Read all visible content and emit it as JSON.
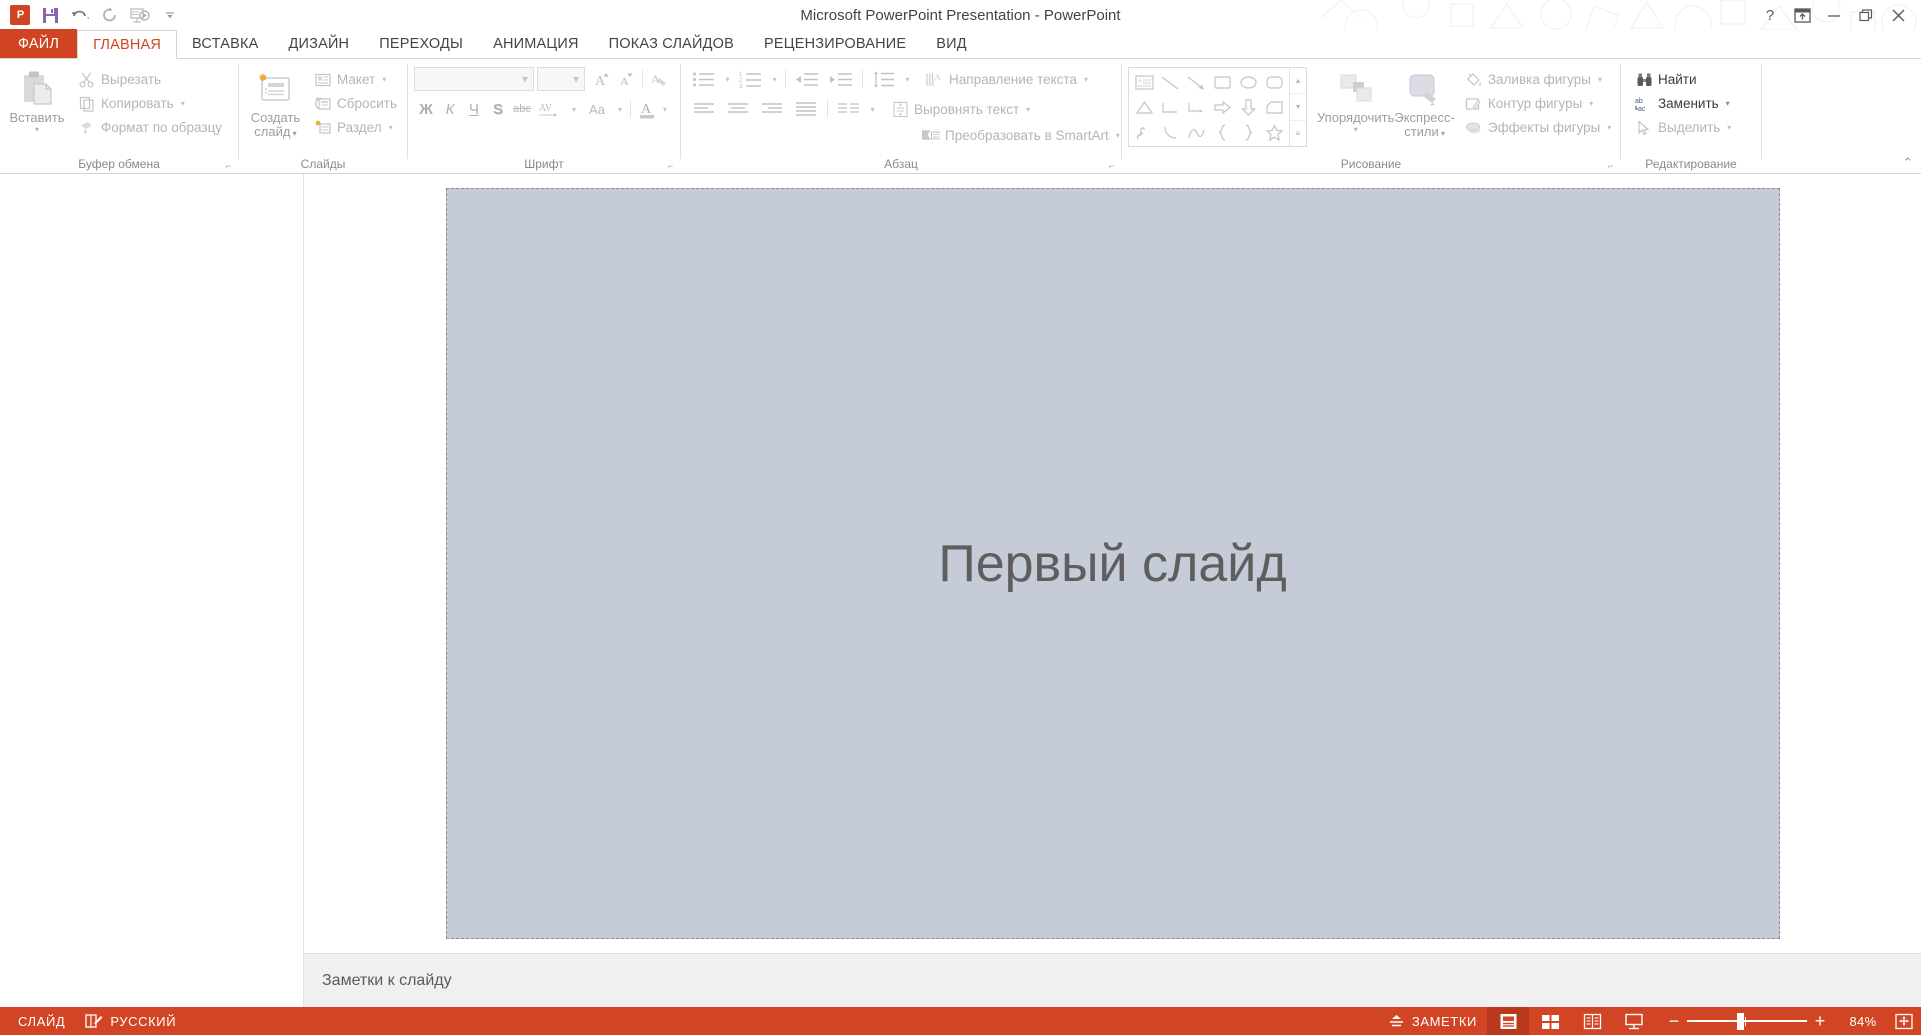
{
  "titlebar": {
    "app_icon": "powerpoint-logo",
    "title": "Microsoft PowerPoint Presentation - PowerPoint",
    "qat": [
      {
        "name": "save",
        "icon": "save-icon"
      },
      {
        "name": "undo",
        "icon": "undo-icon"
      },
      {
        "name": "redo",
        "icon": "redo-icon"
      },
      {
        "name": "start-slideshow",
        "icon": "slideshow-icon"
      },
      {
        "name": "customize-qat",
        "icon": "chevron-down-icon"
      }
    ],
    "window_buttons": [
      {
        "name": "help",
        "glyph": "?"
      },
      {
        "name": "ribbon-display-options",
        "glyph": "ribbon"
      },
      {
        "name": "minimize",
        "glyph": "–"
      },
      {
        "name": "restore",
        "glyph": "restore"
      },
      {
        "name": "close",
        "glyph": "✕"
      }
    ]
  },
  "tabs": [
    {
      "label": "ФАЙЛ",
      "type": "file"
    },
    {
      "label": "ГЛАВНАЯ",
      "type": "active"
    },
    {
      "label": "ВСТАВКА",
      "type": "normal"
    },
    {
      "label": "ДИЗАЙН",
      "type": "normal"
    },
    {
      "label": "ПЕРЕХОДЫ",
      "type": "normal"
    },
    {
      "label": "АНИМАЦИЯ",
      "type": "normal"
    },
    {
      "label": "ПОКАЗ СЛАЙДОВ",
      "type": "normal"
    },
    {
      "label": "РЕЦЕНЗИРОВАНИЕ",
      "type": "normal"
    },
    {
      "label": "ВИД",
      "type": "normal"
    }
  ],
  "ribbon": {
    "collapse_icon": "chevron-up-icon",
    "groups": {
      "clipboard": {
        "label": "Буфер обмена",
        "paste": "Вставить",
        "cut": "Вырезать",
        "copy": "Копировать",
        "format_painter": "Формат по образцу"
      },
      "slides": {
        "label": "Слайды",
        "new_slide": "Создать\nслайд",
        "new_slide_l1": "Создать",
        "new_slide_l2": "слайд",
        "layout": "Макет",
        "reset": "Сбросить",
        "section": "Раздел"
      },
      "font": {
        "label": "Шрифт",
        "font_name": "",
        "font_size": "",
        "bold": "Ж",
        "italic": "К",
        "underline": "Ч",
        "shadow": "S",
        "strikethrough": "abc",
        "spacing": "AV",
        "case": "Aa",
        "color": "A",
        "grow_font": "A",
        "shrink_font": "A",
        "clear_format": "clear-formatting-icon"
      },
      "paragraph": {
        "label": "Абзац",
        "text_direction": "Направление текста",
        "align_text": "Выровнять текст",
        "convert_smartart": "Преобразовать в SmartArt"
      },
      "drawing": {
        "label": "Рисование",
        "arrange": "Упорядочить",
        "quick_styles_l1": "Экспресс-",
        "quick_styles_l2": "стили",
        "shape_fill": "Заливка фигуры",
        "shape_outline": "Контур фигуры",
        "shape_effects": "Эффекты фигуры"
      },
      "editing": {
        "label": "Редактирование",
        "find": "Найти",
        "replace": "Заменить",
        "select": "Выделить"
      }
    }
  },
  "slide": {
    "title": "Первый слайд"
  },
  "notes": {
    "placeholder": "Заметки к слайду"
  },
  "statusbar": {
    "slide_label": "СЛАЙД",
    "language": "РУССКИЙ",
    "notes_button": "ЗАМЕТКИ",
    "spellcheck_icon": "spellcheck-icon",
    "views": [
      {
        "name": "normal-view",
        "active": true
      },
      {
        "name": "slide-sorter-view",
        "active": false
      },
      {
        "name": "reading-view",
        "active": false
      },
      {
        "name": "slideshow-view",
        "active": false
      }
    ],
    "zoom_out": "−",
    "zoom_in": "+",
    "zoom_percent": "84%",
    "fit_to_window": "fit-slide-icon"
  },
  "colors": {
    "accent": "#d14524",
    "statusbar": "#d14524",
    "slide_bg": "#c6ccd7",
    "ribbon_disabled": "#b5b5b5"
  }
}
